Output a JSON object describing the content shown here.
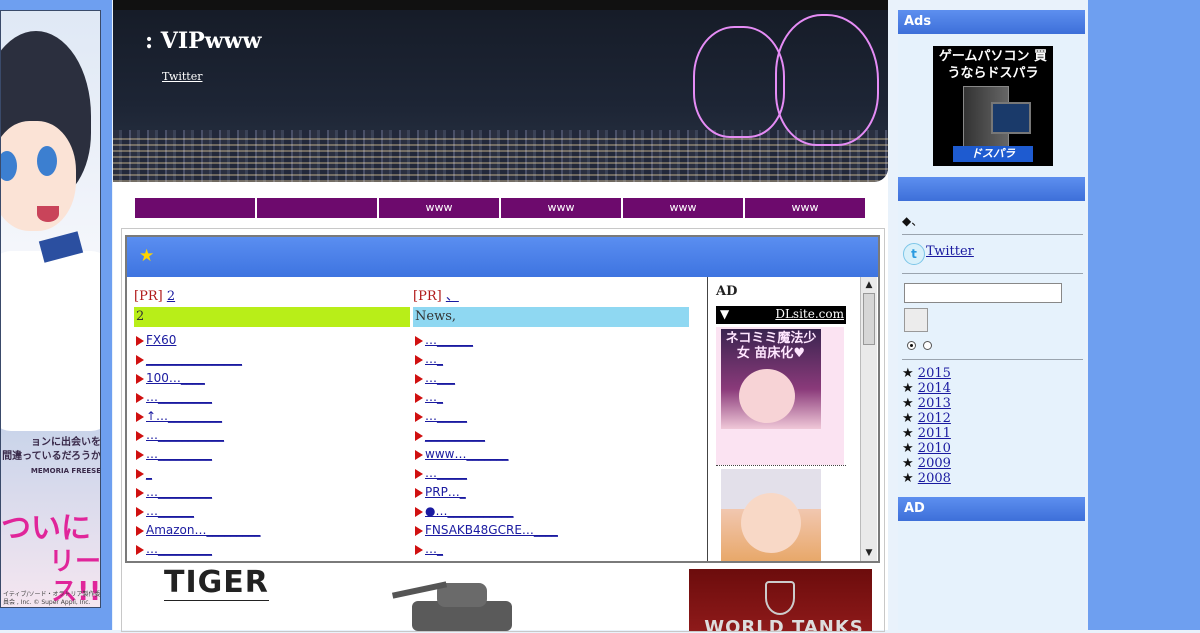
{
  "left_ad": {
    "title_lines": [
      "ョンに出会いを",
      "間違っているだろうか"
    ],
    "subtitle": "MEMORIA FREESE",
    "tagline1": "ついに",
    "tagline2": "リース!!",
    "copyright": "イティブ/ソード・オラトリア製作委員会 , Inc. © Super Appli, Inc."
  },
  "header": {
    "site_title": ": VIPwww",
    "twitter_link": "Twitter"
  },
  "nav": {
    "items": [
      "",
      "",
      "www",
      "www",
      "www",
      "www"
    ]
  },
  "main": {
    "star_icon": "★",
    "left_column": {
      "pr_label": "[PR]",
      "pr_link": "2",
      "title": "2",
      "items": [
        "FX60",
        "________________",
        "100…____",
        "…_________",
        "↑…_________",
        "…___________",
        "…_________",
        "_",
        "…_________",
        "…______",
        "Amazon…_________",
        "…_________"
      ]
    },
    "right_column": {
      "pr_label": "[PR]",
      "pr_link": "、",
      "title": "News,",
      "items": [
        "…______",
        "…_",
        "…___",
        "…_",
        "…_____",
        "__________",
        "www…_______",
        "…_____",
        "PRP…_",
        "●…___________",
        "FNSAKB48GCRE…____",
        "…_"
      ]
    },
    "ad": {
      "label": "AD",
      "arrow": "▼",
      "dlsite": "DLsite.com",
      "img1_text": "ネコミミ魔法少女 苗床化♥"
    }
  },
  "bottom": {
    "tiger_logo": "TIGER",
    "wot_text": "WORLD TANKS"
  },
  "sidebar": {
    "ads_header": "Ads",
    "dospara_text": "ゲームパソコン 買うならドスパラ",
    "dospara_brand": "ドスパラ",
    "section2_header": "",
    "bullet_text": "◆、",
    "twitter_label": " Twitter ",
    "search_value": "",
    "years_header_bullet": "★",
    "years": [
      "2015",
      "2014",
      "2013",
      "2012",
      "2011",
      "2010",
      "2009",
      "2008"
    ],
    "ad_header": "AD"
  },
  "colors": {
    "page_side": "#6e9ff0",
    "nav_bg": "#6d0a6d",
    "box_head": "#4a80e8",
    "green_title": "#b8ee18",
    "blue_title": "#8fd8f2",
    "bullet_red": "#d01010",
    "link": "#1a1aa0"
  },
  "icons": {
    "list_bullet": "red-triangle-icon",
    "twitter": "twitter-icon",
    "star": "star-icon",
    "scroll_up": "scroll-up-icon",
    "scroll_down": "scroll-down-icon"
  }
}
